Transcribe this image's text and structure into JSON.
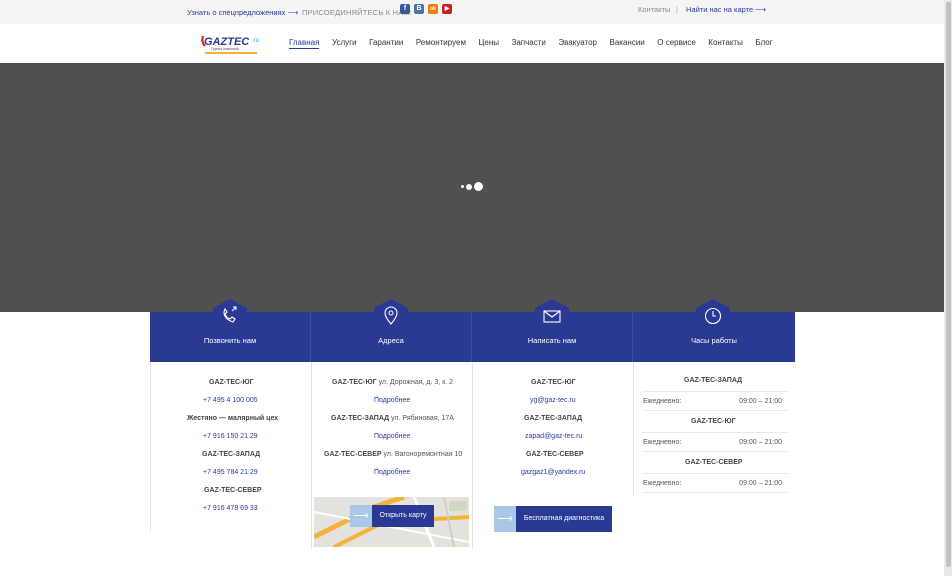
{
  "topbar": {
    "promo_link": "Узнать о спецпредложениях ⟶",
    "join_label": "ПРИСОЕДИНЯЙТЕСЬ К НАМ:",
    "contacts": "Контакты",
    "separator": "|",
    "map_link": "Найти нас на карте ⟶",
    "social": [
      {
        "icon": "facebook-icon",
        "glyph": "f",
        "color": "#3b5998"
      },
      {
        "icon": "vk-icon",
        "glyph": "В",
        "color": "#4a76a8"
      },
      {
        "icon": "odnoklassniki-icon",
        "glyph": "ok",
        "color": "#ee8208"
      },
      {
        "icon": "youtube-icon",
        "glyph": "▶",
        "color": "#cd201f"
      }
    ]
  },
  "header": {
    "logo_text": "GAZTEC",
    "logo_suffix": ".ru",
    "logo_tagline": "Группа компаний",
    "nav": [
      "Главная",
      "Услуги",
      "Гарантии",
      "Ремонтируем",
      "Цены",
      "Запчасти",
      "Эвакуатор",
      "Вакансии",
      "О сервисе",
      "Контакты",
      "Блог"
    ]
  },
  "band": {
    "call": "Позвонить нам",
    "address": "Адреса",
    "write": "Написать нам",
    "hours": "Часы работы"
  },
  "phones": {
    "yug_title": "GAZ-TEC-ЮГ",
    "yug_phone": "+7 495 4 100 005",
    "body_shop": "Жестяно — малярный цех",
    "body_shop_phone": "+7 916 150 21 29",
    "zapad_title": "GAZ-TEC-ЗАПАД",
    "zapad_phone": "+7 495 784 21 29",
    "sever_title": "GAZ-TEC-СЕВЕР",
    "sever_phone": "+7 916 478 69 33"
  },
  "addresses": {
    "yug_title": "GAZ-TEC-ЮГ",
    "yug_addr": " ул. Дорожная, д. 3, к. 2",
    "more": "Подробнее",
    "zapad_title": "GAZ-TEC-ЗАПАД",
    "zapad_addr": "  ул. Рябиновая, 17А",
    "sever_title": "GAZ-TEC-СЕВЕР",
    "sever_addr": " ул. Вагоноремонтная 10",
    "open_map": "Открыть карту"
  },
  "emails": {
    "yug_title": "GAZ-TEC-ЮГ",
    "yug_email": "yg@gaz-tec.ru",
    "zapad_title": "GAZ-TEC-ЗАПАД",
    "zapad_email": "zapad@gaz-tec.ru",
    "sever_title": "GAZ-TEC-СЕВЕР",
    "sever_email": "gazgaz1@yandex.ru",
    "diagnostics": "Бесплатная диагностика"
  },
  "hours": {
    "zapad_title": "GAZ-TEC-ЗАПАД",
    "yug_title": "GAZ-TEC-ЮГ",
    "sever_title": "GAZ-TEC-СЕВЕР",
    "daily": "Ежедневно:",
    "time": "09:00 – 21:00"
  }
}
